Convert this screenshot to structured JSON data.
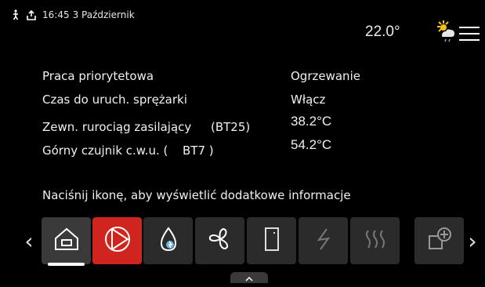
{
  "status": {
    "time": "16:45",
    "date": "3 Październik",
    "outdoor_temp": "22.0°",
    "weather_icon": "sun-cloud-rain-icon"
  },
  "info": {
    "rows": [
      {
        "label": "Praca priorytetowa",
        "value": "Ogrzewanie"
      },
      {
        "label": "Czas do uruch. sprężarki",
        "value": "Włącz"
      },
      {
        "label": "Zewn. rurociąg zasilający",
        "label_code": "(BT25)",
        "value": "38.2°C"
      },
      {
        "label": "Górny czujnik c.w.u. (",
        "label_code": "BT7 )",
        "value": "54.2°C"
      }
    ],
    "hint": "Naciśnij ikonę, aby wyświetlić dodatkowe informacje"
  },
  "icons": [
    {
      "name": "home-icon",
      "state": "selected"
    },
    {
      "name": "compressor-icon",
      "state": "alarm",
      "color": "#d0251e"
    },
    {
      "name": "hot-water-icon",
      "state": "normal"
    },
    {
      "name": "fan-icon",
      "state": "normal"
    },
    {
      "name": "tank-icon",
      "state": "dim"
    },
    {
      "name": "electric-heater-icon",
      "state": "dim"
    },
    {
      "name": "floor-heating-icon",
      "state": "dim"
    },
    {
      "name": "add-icon",
      "state": "dim"
    }
  ],
  "colors": {
    "background": "#000000",
    "tile": "#2b2b2b",
    "alarm": "#d0251e"
  }
}
